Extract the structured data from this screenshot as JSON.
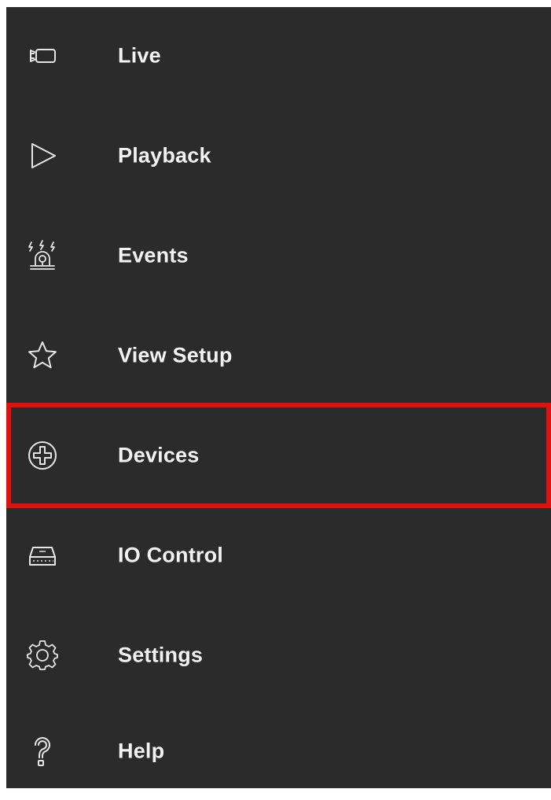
{
  "menu": {
    "items": [
      {
        "label": "Live",
        "icon": "camera-icon"
      },
      {
        "label": "Playback",
        "icon": "play-icon"
      },
      {
        "label": "Events",
        "icon": "alarm-icon"
      },
      {
        "label": "View Setup",
        "icon": "star-icon"
      },
      {
        "label": "Devices",
        "icon": "add-circle-icon"
      },
      {
        "label": "IO Control",
        "icon": "io-device-icon"
      },
      {
        "label": "Settings",
        "icon": "gear-icon"
      },
      {
        "label": "Help",
        "icon": "question-icon"
      }
    ],
    "highlighted_item": "Devices"
  },
  "colors": {
    "background": "#2b2b2b",
    "text": "#f2f2f2",
    "icon": "#e6e6e6",
    "highlight_border": "#e01010"
  }
}
